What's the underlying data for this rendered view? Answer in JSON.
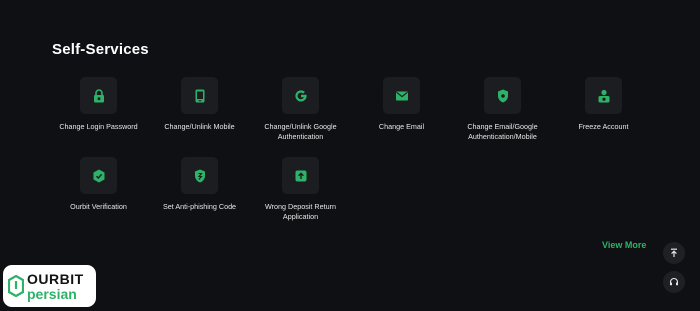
{
  "section": {
    "title": "Self-Services"
  },
  "services": [
    {
      "label": "Change Login Password",
      "icon": "lock-icon"
    },
    {
      "label": "Change/Unlink Mobile",
      "icon": "mobile-icon"
    },
    {
      "label": "Change/Unlink Google Authentication",
      "icon": "google-icon"
    },
    {
      "label": "Change Email",
      "icon": "envelope-icon"
    },
    {
      "label": "Change Email/Google Authentication/Mobile",
      "icon": "shield-icon"
    },
    {
      "label": "Freeze Account",
      "icon": "user-lock-icon"
    },
    {
      "label": "Ourbit Verification",
      "icon": "verified-badge-icon"
    },
    {
      "label": "Set Anti-phishing Code",
      "icon": "shield-check-icon"
    },
    {
      "label": "Wrong Deposit Return Application",
      "icon": "deposit-return-icon"
    }
  ],
  "view_more": "View More",
  "floating": {
    "top_icon": "scroll-to-top-icon",
    "support_icon": "headset-icon"
  },
  "logo": {
    "word1": "OURBIT",
    "word2": "persian"
  },
  "colors": {
    "background": "#0f1013",
    "tile": "#1c1d21",
    "accent": "#2db368",
    "text": "#e6e6e6"
  }
}
